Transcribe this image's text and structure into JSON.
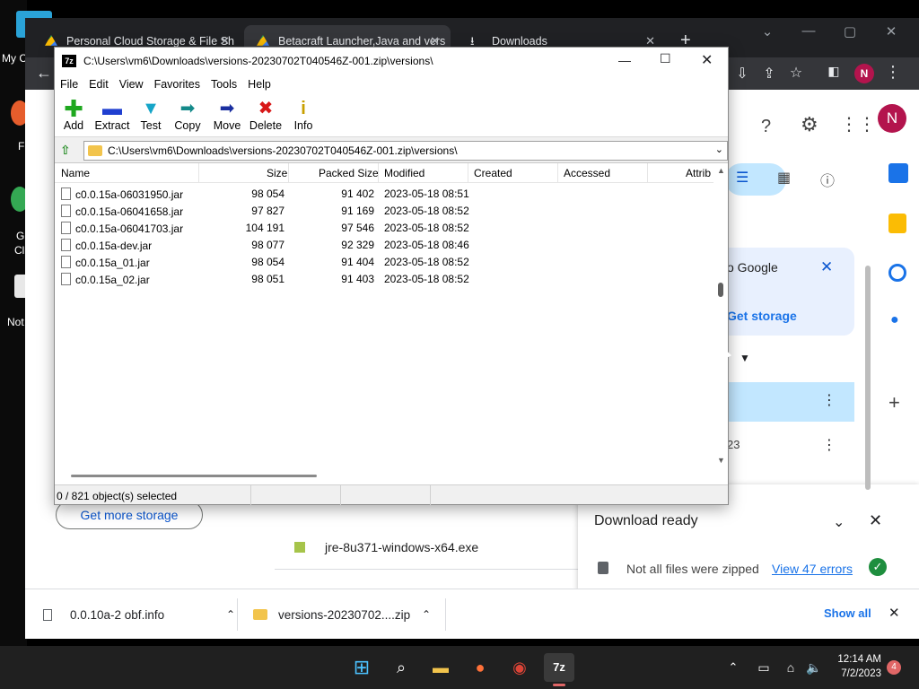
{
  "desktop": {
    "labels": [
      "My C",
      "F",
      "G",
      "Cl",
      "Not"
    ]
  },
  "chrome": {
    "tabs": [
      {
        "title": "Personal Cloud Storage & File Sh"
      },
      {
        "title": "Betacraft Launcher,Java and vers"
      },
      {
        "title": "Downloads"
      }
    ],
    "new_tab": "+",
    "avatar_initial": "N",
    "drive": {
      "promo_text": "o Google",
      "promo_link": "Get storage",
      "row_text": "23",
      "get_more_storage": "Get more storage",
      "file_name": "jre-8u371-windows-x64.exe",
      "download_ready": "Download ready",
      "not_all_zipped": "Not all files were zipped",
      "view_errors": "View 47 errors"
    },
    "download_bar": {
      "items": [
        {
          "name": "0.0.10a-2 obf.info"
        },
        {
          "name": "versions-20230702....zip"
        }
      ],
      "show_all": "Show all"
    }
  },
  "zip": {
    "title": "C:\\Users\\vm6\\Downloads\\versions-20230702T040546Z-001.zip\\versions\\",
    "logo": "7z",
    "menu": [
      "File",
      "Edit",
      "View",
      "Favorites",
      "Tools",
      "Help"
    ],
    "tools": [
      {
        "label": "Add",
        "icon": "add-icon",
        "color": "#1fa81f"
      },
      {
        "label": "Extract",
        "icon": "extract-icon",
        "color": "#1f3fd0"
      },
      {
        "label": "Test",
        "icon": "test-icon",
        "color": "#16a5c8"
      },
      {
        "label": "Copy",
        "icon": "copy-icon",
        "color": "#148a8a"
      },
      {
        "label": "Move",
        "icon": "move-icon",
        "color": "#1a2fa0"
      },
      {
        "label": "Delete",
        "icon": "delete-icon",
        "color": "#d81818"
      },
      {
        "label": "Info",
        "icon": "info-icon",
        "color": "#c8a000"
      }
    ],
    "address": "C:\\Users\\vm6\\Downloads\\versions-20230702T040546Z-001.zip\\versions\\",
    "columns": [
      "Name",
      "Size",
      "Packed Size",
      "Modified",
      "Created",
      "Accessed",
      "Attrib"
    ],
    "rows": [
      {
        "name": "c0.0.15a-06031950.jar",
        "size": "98 054",
        "packed": "91 402",
        "modified": "2023-05-18 08:51"
      },
      {
        "name": "c0.0.15a-06041658.jar",
        "size": "97 827",
        "packed": "91 169",
        "modified": "2023-05-18 08:52"
      },
      {
        "name": "c0.0.15a-06041703.jar",
        "size": "104 191",
        "packed": "97 546",
        "modified": "2023-05-18 08:52"
      },
      {
        "name": "c0.0.15a-dev.jar",
        "size": "98 077",
        "packed": "92 329",
        "modified": "2023-05-18 08:46"
      },
      {
        "name": "c0.0.15a_01.jar",
        "size": "98 054",
        "packed": "91 404",
        "modified": "2023-05-18 08:52"
      },
      {
        "name": "c0.0.15a_02.jar",
        "size": "98 051",
        "packed": "91 403",
        "modified": "2023-05-18 08:52"
      }
    ],
    "status": "0 / 821 object(s) selected"
  },
  "taskbar": {
    "time": "12:14 AM",
    "date": "7/2/2023",
    "badge": "4"
  }
}
